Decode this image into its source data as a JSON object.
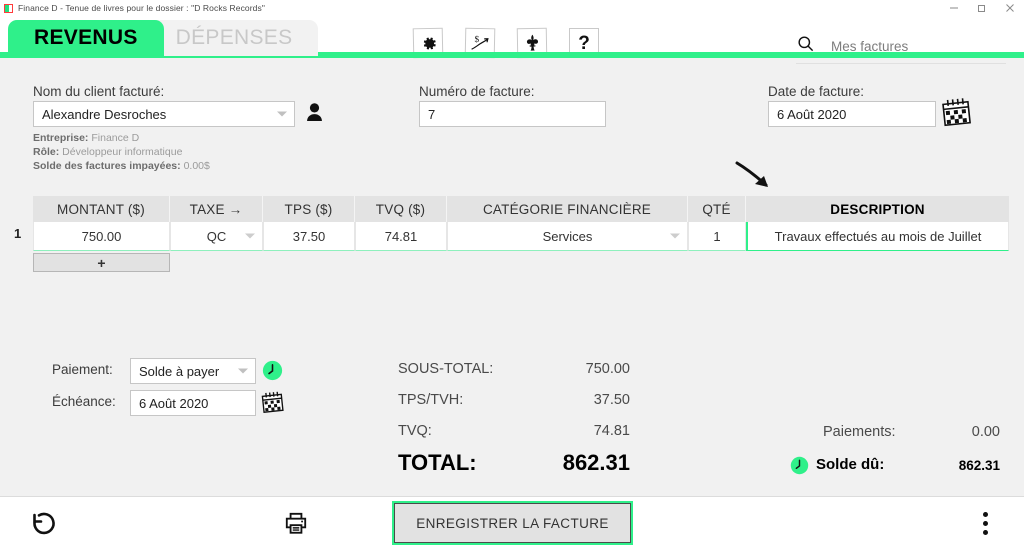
{
  "window": {
    "title": "Finance D - Tenue de livres pour le dossier : \"D Rocks Records\"",
    "minimize": "–",
    "maximize": "❐",
    "close": "✕"
  },
  "tabs": [
    {
      "label": "REVENUS",
      "active": true
    },
    {
      "label": "DÉPENSES",
      "active": false
    }
  ],
  "toolbar": {
    "icons": [
      {
        "name": "gear-icon",
        "glyph": "⚙"
      },
      {
        "name": "dollar-chart-icon",
        "glyph": "$"
      },
      {
        "name": "fleur-de-lis-icon",
        "glyph": "⚜"
      },
      {
        "name": "help-icon",
        "glyph": "?"
      }
    ]
  },
  "search": {
    "icon": "search-icon",
    "placeholder": "Mes factures",
    "value": "Mes factures"
  },
  "client": {
    "label": "Nom du client facturé:",
    "value": "Alexandre Desroches",
    "icon": "person-icon",
    "company_label": "Entreprise:",
    "company_value": "Finance D",
    "role_label": "Rôle:",
    "role_value": "Développeur informatique",
    "balance_label": "Solde des factures impayées:",
    "balance_value": "0.00$"
  },
  "invoice_number": {
    "label": "Numéro de facture:",
    "value": "7"
  },
  "invoice_date": {
    "label": "Date de facture:",
    "value": "6 Août 2020",
    "icon": "calendar-icon"
  },
  "table": {
    "headers": [
      "MONTANT ($)",
      "TAXE →",
      "TPS ($)",
      "TVQ ($)",
      "CATÉGORIE FINANCIÈRE",
      "QTÉ",
      "DESCRIPTION"
    ],
    "rows": [
      {
        "number": "1",
        "montant": "750.00",
        "taxe": "QC",
        "tps": "37.50",
        "tvq": "74.81",
        "categorie": "Services",
        "qte": "1",
        "description": "Travaux effectués au mois de Juillet"
      }
    ],
    "add_row_label": "+"
  },
  "payment": {
    "paiement_label": "Paiement:",
    "paiement_value": "Solde à payer",
    "paiement_icon": "clock-icon",
    "echeance_label": "Échéance:",
    "echeance_value": "6 Août 2020",
    "echeance_icon": "calendar-icon"
  },
  "totals": {
    "subtotal_label": "SOUS-TOTAL:",
    "subtotal_value": "750.00",
    "tps_label": "TPS/TVH:",
    "tps_value": "37.50",
    "tvq_label": "TVQ:",
    "tvq_value": "74.81",
    "total_label": "TOTAL:",
    "total_value": "862.31",
    "payments_label": "Paiements:",
    "payments_value": "0.00",
    "balance_due_label": "Solde dû:",
    "balance_due_value": "862.31",
    "balance_due_icon": "clock-icon"
  },
  "bottom": {
    "undo_icon": "undo-icon",
    "print_icon": "printer-icon",
    "save_label": "ENREGISTRER LA FACTURE",
    "menu_icon": "kebab-menu-icon"
  },
  "annotation": {
    "arrow_icon": "arrow-down-right-icon"
  },
  "colors": {
    "accent_green": "#2ff08a",
    "header_gray": "#e3e3e3",
    "page_bg": "#f1f1f1"
  }
}
